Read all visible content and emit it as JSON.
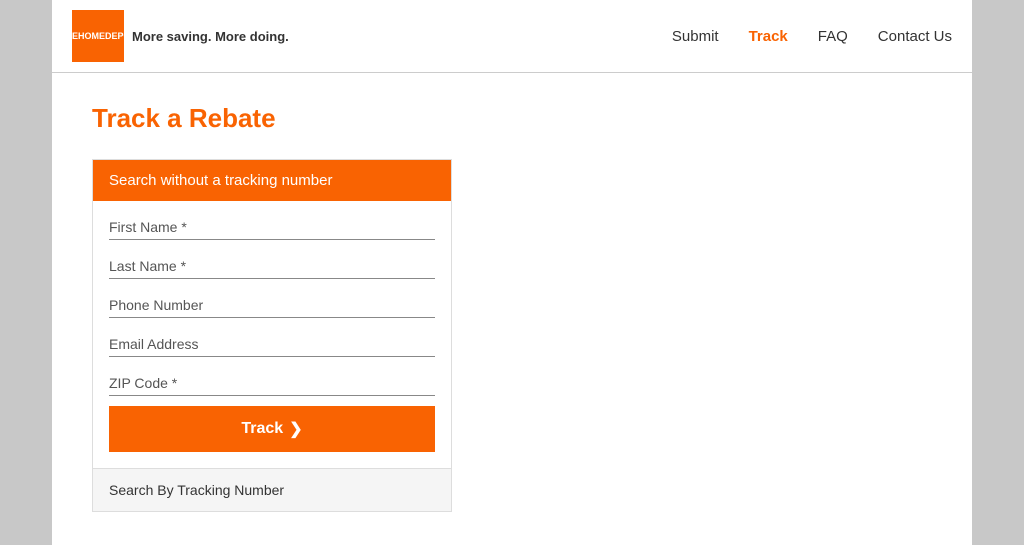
{
  "header": {
    "logo_line1": "THE",
    "logo_line2": "HOME",
    "logo_line3": "DEPOT",
    "tagline_normal": "More saving.",
    "tagline_bold": "More doing.",
    "nav": [
      {
        "label": "Submit",
        "active": false
      },
      {
        "label": "Track",
        "active": true
      },
      {
        "label": "FAQ",
        "active": false
      },
      {
        "label": "Contact Us",
        "active": false
      }
    ]
  },
  "main": {
    "page_title": "Track a Rebate",
    "form_card": {
      "header_label": "Search without a tracking number",
      "fields": [
        {
          "placeholder": "First Name *"
        },
        {
          "placeholder": "Last Name *"
        },
        {
          "placeholder": "Phone Number"
        },
        {
          "placeholder": "Email Address"
        },
        {
          "placeholder": "ZIP Code *"
        }
      ],
      "track_button_label": "Track",
      "track_button_arrow": "❯",
      "footer_label": "Search By Tracking Number"
    }
  }
}
